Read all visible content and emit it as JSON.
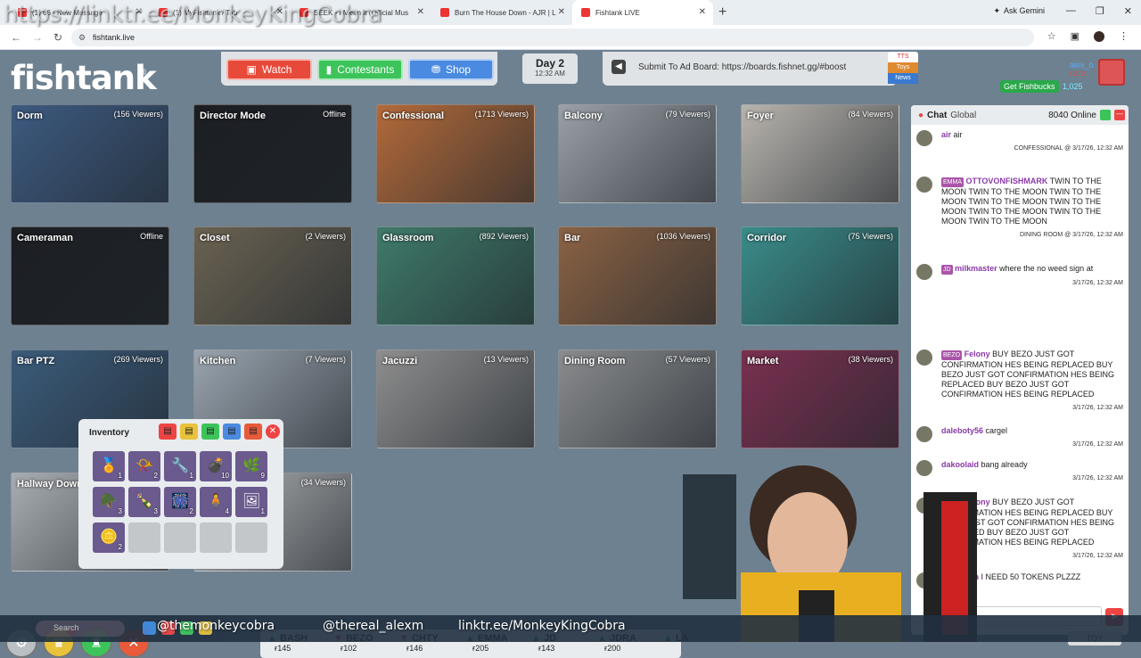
{
  "browser": {
    "tabs": [
      {
        "label": "(1) 66 - New Message",
        "active": false
      },
      {
        "label": "(1) MyFishtank / Tab",
        "active": false
      },
      {
        "label": "SEEK - I Mean It (Official Mus",
        "active": false
      },
      {
        "label": "Burn The House Down - AJR | L",
        "active": false
      },
      {
        "label": "Fishtank LIVE",
        "active": true
      }
    ],
    "new_tab": "+",
    "gemini": "Ask Gemini",
    "url": "fishtank.live"
  },
  "overlay": {
    "top_link": "https://linktr.ee/MonkeyKingCobra",
    "bottom_link": "linktr.ee/MonkeyKingCobra",
    "bottom_handle": "@themonkeycobra",
    "bottom_handle2": "@thereal_alexm"
  },
  "header": {
    "logo": "fishtank",
    "nav": {
      "watch": "Watch",
      "contestants": "Contestants",
      "shop": "Shop"
    },
    "day": "Day 2",
    "time": "12:32 AM",
    "ad_board": "Submit To Ad Board: https://boards.fishnet.gg/#boost",
    "tags": [
      "TTS",
      "Toys",
      "News"
    ],
    "user": {
      "name": "alex_b",
      "level": "LVL 2",
      "get_fishbucks": "Get Fishbucks",
      "balance": "1,025"
    }
  },
  "cameras": [
    {
      "name": "Dorm",
      "viewers": "(156 Viewers)",
      "color": "#3d5a80"
    },
    {
      "name": "Director Mode",
      "viewers": "Offline",
      "color": "#1c1e22"
    },
    {
      "name": "Confessional",
      "viewers": "(1713 Viewers)",
      "color": "#b26a3a"
    },
    {
      "name": "Balcony",
      "viewers": "(79 Viewers)",
      "color": "#9aa0a6"
    },
    {
      "name": "Foyer",
      "viewers": "(84 Viewers)",
      "color": "#b8b4ae"
    },
    {
      "name": "Cameraman",
      "viewers": "Offline",
      "color": "#1c1e22"
    },
    {
      "name": "Closet",
      "viewers": "(2 Viewers)",
      "color": "#6a6252"
    },
    {
      "name": "Glassroom",
      "viewers": "(892 Viewers)",
      "color": "#3f7a6a"
    },
    {
      "name": "Bar",
      "viewers": "(1036 Viewers)",
      "color": "#8a6244"
    },
    {
      "name": "Corridor",
      "viewers": "(75 Viewers)",
      "color": "#3a8c8a"
    },
    {
      "name": "Bar PTZ",
      "viewers": "(269 Viewers)",
      "color": "#3b5b7a"
    },
    {
      "name": "Kitchen",
      "viewers": "(7 Viewers)",
      "color": "#9aa4ae"
    },
    {
      "name": "Jacuzzi",
      "viewers": "(13 Viewers)",
      "color": "#8e8e8e"
    },
    {
      "name": "Dining Room",
      "viewers": "(57 Viewers)",
      "color": "#8a8c8e"
    },
    {
      "name": "Market",
      "viewers": "(38 Viewers)",
      "color": "#7a3050"
    },
    {
      "name": "Hallway Down",
      "viewers": "",
      "color": "#a8adb2"
    },
    {
      "name": "",
      "viewers": "(34 Viewers)",
      "color": "#b2b4b6"
    }
  ],
  "inventory": {
    "title": "Inventory",
    "items": [
      {
        "icon": "medal-icon",
        "glyph": "🏅",
        "count": "1"
      },
      {
        "icon": "horn-icon",
        "glyph": "📯",
        "count": "2"
      },
      {
        "icon": "tool-icon",
        "glyph": "🔧",
        "count": "1"
      },
      {
        "icon": "grenade-icon",
        "glyph": "💣",
        "count": "10"
      },
      {
        "icon": "herb-icon",
        "glyph": "🌿",
        "count": "9"
      },
      {
        "icon": "helmet-icon",
        "glyph": "🪖",
        "count": "3"
      },
      {
        "icon": "bottle-icon",
        "glyph": "🍾",
        "count": "3"
      },
      {
        "icon": "firework-icon",
        "glyph": "🎆",
        "count": "2"
      },
      {
        "icon": "figure-icon",
        "glyph": "🧍",
        "count": "4"
      },
      {
        "icon": "portrait-icon",
        "glyph": "🖼",
        "count": "1"
      },
      {
        "icon": "coin-icon",
        "glyph": "🪙",
        "count": "2"
      }
    ]
  },
  "chat": {
    "title": "Chat",
    "room": "Global",
    "online": "8040 Online",
    "messages": [
      {
        "user": "air",
        "text": "air",
        "meta": "CONFESSIONAL @ 3/17/26, 12:32 AM"
      },
      {
        "user": "OTTOVONFISHMARK",
        "badge": "EMMA",
        "text": "TWIN TO THE MOON TWIN TO THE MOON TWIN TO THE MOON TWIN TO THE MOON TWIN TO THE MOON TWIN TO THE MOON TWIN TO THE MOON TWIN TO THE MOON",
        "meta": "DINING ROOM @ 3/17/26, 12:32 AM"
      },
      {
        "user": "milkmaster",
        "badge": "JD",
        "text": "where the no weed sign at",
        "meta": "3/17/26, 12:32 AM"
      },
      {
        "user": "Felony",
        "badge": "BEZO",
        "text": "BUY BEZO JUST GOT CONFIRMATION HES BEING REPLACED BUY BEZO JUST GOT CONFIRMATION HES BEING REPLACED BUY BEZO JUST GOT CONFIRMATION HES BEING REPLACED",
        "meta": "3/17/26, 12:32 AM"
      },
      {
        "user": "daleboty56",
        "text": "cargel",
        "meta": "3/17/26, 12:32 AM"
      },
      {
        "user": "dakoolaid",
        "text": "bang already",
        "meta": "3/17/26, 12:32 AM"
      },
      {
        "user": "Felony",
        "badge": "BEZO",
        "text": "BUY BEZO JUST GOT CONFIRMATION HES BEING REPLACED BUY BEZO JUST GOT CONFIRMATION HES BEING REPLACED BUY BEZO JUST GOT CONFIRMATION HES BEING REPLACED",
        "meta": "3/17/26, 12:32 AM"
      },
      {
        "user": "its_Zaltan",
        "text": "I NEED 50 TOKENS PLZZZ",
        "meta": ""
      }
    ],
    "toy": "TOY"
  },
  "ticker": [
    {
      "name": "BASH",
      "dir": "up",
      "price": "ғ145"
    },
    {
      "name": "BEZO",
      "dir": "down",
      "price": "ғ102"
    },
    {
      "name": "CHTY",
      "dir": "down",
      "price": "ғ146"
    },
    {
      "name": "EMMA",
      "dir": "up",
      "price": "ғ205"
    },
    {
      "name": "JD",
      "dir": "up",
      "price": "ғ143"
    },
    {
      "name": "JDRA",
      "dir": "up",
      "price": "ғ200"
    },
    {
      "name": "LA",
      "dir": "up",
      "price": ""
    }
  ],
  "taskbar": {
    "search": "Search"
  }
}
